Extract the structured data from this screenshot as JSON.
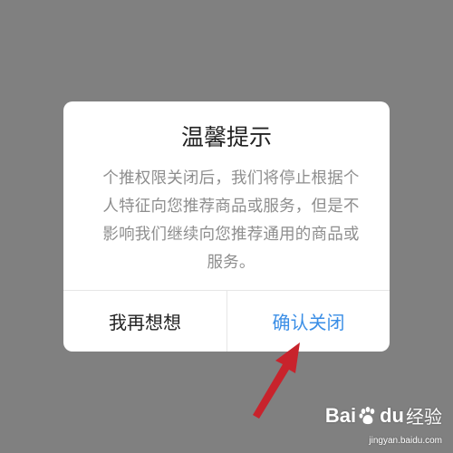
{
  "dialog": {
    "title": "温馨提示",
    "message": "个推权限关闭后，我们将停止根据个人特征向您推荐商品或服务，但是不影响我们继续向您推荐通用的商品或服务。",
    "cancel_label": "我再想想",
    "confirm_label": "确认关闭"
  },
  "watermark": {
    "logo_text_bai": "Bai",
    "logo_text_du": "du",
    "logo_text_jingyan": "经验",
    "url": "jingyan.baidu.com"
  },
  "colors": {
    "overlay": "#808080",
    "dialog_bg": "#ffffff",
    "title_text": "#222222",
    "message_text": "#8e8e8e",
    "confirm_text": "#3a8ee6",
    "arrow": "#c8232c"
  },
  "icons": {
    "annotation": "red-arrow-icon",
    "logo": "baidu-paw-icon"
  }
}
